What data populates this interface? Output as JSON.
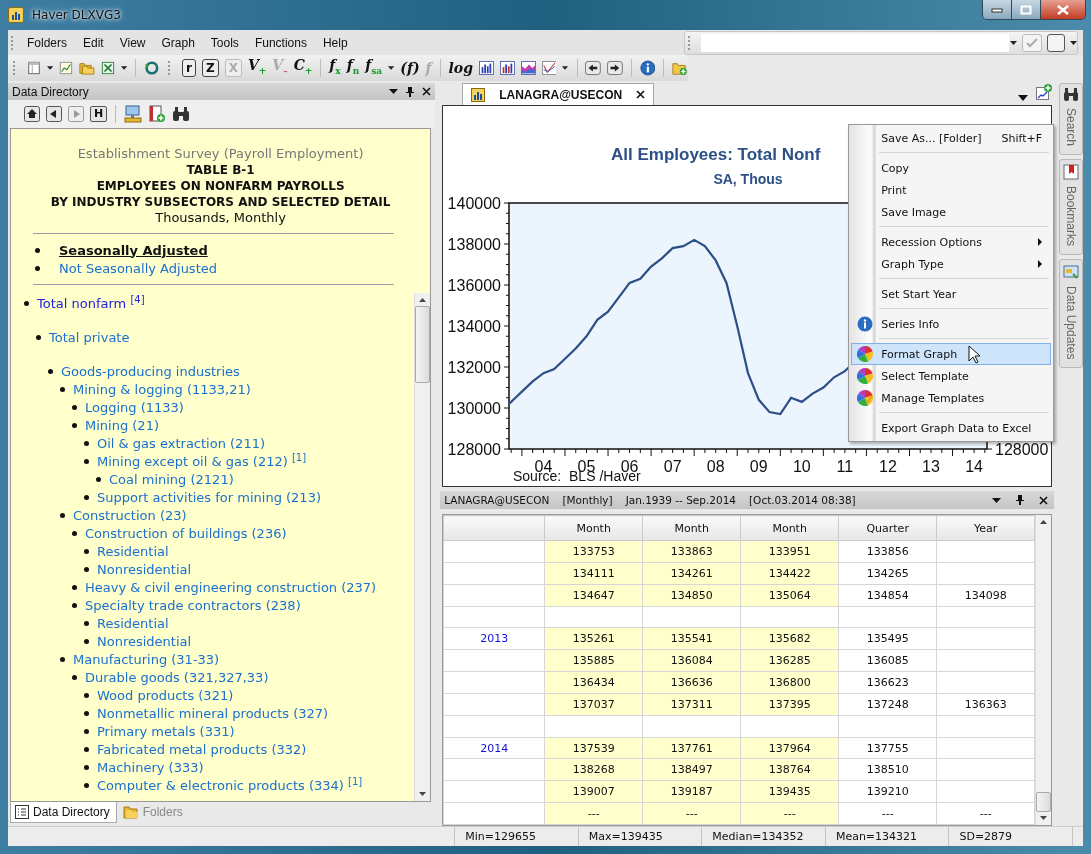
{
  "window": {
    "title": "Haver DLXVG3"
  },
  "menu": [
    "Folders",
    "Edit",
    "View",
    "Graph",
    "Tools",
    "Functions",
    "Help"
  ],
  "toolbar": {
    "glyph_buttons": [
      {
        "text": "r",
        "disabled": false
      },
      {
        "text": "Z",
        "disabled": false
      },
      {
        "text": "X",
        "disabled": true
      },
      {
        "text": "V$_{+}$",
        "disabled": false
      },
      {
        "text": "V$_{–}$",
        "disabled": true
      },
      {
        "text": "C$_{+}$",
        "disabled": false
      },
      {
        "text": "*f*$_{x}$",
        "disabled": false
      },
      {
        "text": "*f*$_{n}$",
        "disabled": false
      },
      {
        "text": "*f*$_{sa}$",
        "disabled": false
      },
      {
        "text": "(*f*)",
        "disabled": false
      },
      {
        "text": "*f*",
        "disabled": true
      },
      {
        "text": "log",
        "disabled": false
      }
    ]
  },
  "data_directory": {
    "title": "Data Directory",
    "history_button": "H",
    "heading": [
      {
        "kind": "survey",
        "text": "Establishment Survey (Payroll Employment)"
      },
      {
        "kind": "title",
        "text": "TABLE B-1"
      },
      {
        "kind": "title",
        "text": "EMPLOYEES ON NONFARM PAYROLLS"
      },
      {
        "kind": "title",
        "text": "BY INDUSTRY SUBSECTORS AND SELECTED DETAIL"
      },
      {
        "kind": "units",
        "text": "Thousands, Monthly"
      }
    ],
    "adjustments": [
      {
        "text": "Seasonally Adjusted",
        "selected": true
      },
      {
        "text": "Not Seasonally Adjusted",
        "selected": false
      }
    ],
    "tree": [
      {
        "text": "Total nonfarm $^{[4]}$",
        "children": [
          {
            "text": "Total private",
            "children": [
              {
                "text": "Goods-producing industries",
                "children": [
                  {
                    "text": "Mining & logging (1133,21)",
                    "children": [
                      {
                        "text": "Logging (1133)"
                      },
                      {
                        "text": "Mining (21)",
                        "children": [
                          {
                            "text": "Oil & gas extraction (211)"
                          },
                          {
                            "text": "Mining except oil & gas (212) $^{[1]}$",
                            "children": [
                              {
                                "text": "Coal mining (2121)"
                              }
                            ]
                          },
                          {
                            "text": "Support activities for mining (213)"
                          }
                        ]
                      }
                    ]
                  },
                  {
                    "text": "Construction (23)",
                    "children": [
                      {
                        "text": "Construction of buildings (236)",
                        "children": [
                          {
                            "text": "Residential"
                          },
                          {
                            "text": "Nonresidential"
                          }
                        ]
                      },
                      {
                        "text": "Heavy & civil engineering construction (237)"
                      },
                      {
                        "text": "Specialty trade contractors (238)",
                        "children": [
                          {
                            "text": "Residential"
                          },
                          {
                            "text": "Nonresidential"
                          }
                        ]
                      }
                    ]
                  },
                  {
                    "text": "Manufacturing (31-33)",
                    "children": [
                      {
                        "text": "Durable goods (321,327,33)",
                        "children": [
                          {
                            "text": "Wood products (321)"
                          },
                          {
                            "text": "Nonmetallic mineral products (327)"
                          },
                          {
                            "text": "Primary metals (331)"
                          },
                          {
                            "text": "Fabricated metal products (332)"
                          },
                          {
                            "text": "Machinery (333)"
                          },
                          {
                            "text": "Computer & electronic products (334) $^{[1]}$"
                          }
                        ]
                      }
                    ]
                  }
                ]
              }
            ]
          }
        ]
      }
    ],
    "tabs": [
      {
        "label": "Data Directory",
        "selected": true
      },
      {
        "label": "Folders",
        "selected": false
      }
    ]
  },
  "graph": {
    "tab": "LANAGRA@USECON",
    "chart_data": {
      "type": "line",
      "title": "All Employees: Total Nonf",
      "subtitle": "SA, Thous",
      "x": [
        3.2,
        3.35,
        3.5,
        3.75,
        4.0,
        4.25,
        4.5,
        4.75,
        5.0,
        5.25,
        5.5,
        5.75,
        6.0,
        6.25,
        6.5,
        6.75,
        7.0,
        7.25,
        7.5,
        7.75,
        8.0,
        8.25,
        8.5,
        8.75,
        9.0,
        9.25,
        9.5,
        9.75,
        10.0,
        10.25,
        10.5,
        10.75,
        11.0,
        11.1
      ],
      "values": [
        130200,
        130500,
        130800,
        131300,
        131700,
        131900,
        132400,
        132900,
        133500,
        134300,
        134700,
        135400,
        136100,
        136300,
        136900,
        137300,
        137800,
        137900,
        138200,
        137900,
        137200,
        136100,
        134000,
        131700,
        130400,
        129800,
        129700,
        130500,
        130300,
        130700,
        131000,
        131500,
        131800,
        132000
      ],
      "xlim": [
        3.2,
        14.3
      ],
      "ylim": [
        128000,
        140000
      ],
      "xticks": [
        {
          "value": 4,
          "label": "04"
        },
        {
          "value": 5,
          "label": "05"
        },
        {
          "value": 6,
          "label": "06"
        },
        {
          "value": 7,
          "label": "07"
        },
        {
          "value": 8,
          "label": "08"
        },
        {
          "value": 9,
          "label": "09"
        },
        {
          "value": 10,
          "label": "10"
        },
        {
          "value": 11,
          "label": "11"
        },
        {
          "value": 12,
          "label": "12"
        },
        {
          "value": 13,
          "label": "13"
        },
        {
          "value": 14,
          "label": "14"
        }
      ],
      "yticks": [
        128000,
        130000,
        132000,
        134000,
        136000,
        138000,
        140000
      ]
    },
    "right_axis_label": "128000",
    "source": "Source:  BLS /Haver",
    "context_menu": [
      {
        "kind": "item",
        "label": "Save As... [Folder]",
        "shortcut": "Shift+F",
        "submenu": false,
        "selected": false
      },
      {
        "kind": "separator"
      },
      {
        "kind": "item",
        "label": "Copy",
        "submenu": false,
        "selected": false
      },
      {
        "kind": "item",
        "label": "Print",
        "submenu": false,
        "selected": false
      },
      {
        "kind": "item",
        "label": "Save Image",
        "submenu": false,
        "selected": false
      },
      {
        "kind": "separator"
      },
      {
        "kind": "item",
        "label": "Recession Options",
        "submenu": true,
        "selected": false
      },
      {
        "kind": "item",
        "label": "Graph Type",
        "submenu": true,
        "selected": false
      },
      {
        "kind": "separator"
      },
      {
        "kind": "item",
        "label": "Set Start Year",
        "submenu": false,
        "selected": false
      },
      {
        "kind": "separator"
      },
      {
        "kind": "item",
        "label": "Series Info",
        "submenu": false,
        "selected": false
      },
      {
        "kind": "separator"
      },
      {
        "kind": "item",
        "label": "Format Graph",
        "submenu": false,
        "selected": true
      },
      {
        "kind": "item",
        "label": "Select Template",
        "submenu": false,
        "selected": false
      },
      {
        "kind": "item",
        "label": "Manage Templates",
        "submenu": false,
        "selected": false
      },
      {
        "kind": "separator"
      },
      {
        "kind": "item",
        "label": "Export Graph Data to Excel",
        "submenu": false,
        "selected": false
      }
    ]
  },
  "data_panel": {
    "header": [
      "LANAGRA@USECON",
      "[Monthly]",
      "Jan.1939 -- Sep.2014",
      "[Oct.03.2014 08:38]"
    ],
    "columns": [
      "Month",
      "Month",
      "Month",
      "Quarter",
      "Year"
    ],
    "rows": [
      {
        "cells": [
          "133753",
          "133863",
          "133951",
          "133856",
          null
        ]
      },
      {
        "cells": [
          "134111",
          "134261",
          "134422",
          "134265",
          null
        ]
      },
      {
        "cells": [
          "134647",
          "134850",
          "135064",
          "134854",
          "134098"
        ]
      },
      {
        "kind": "blank"
      },
      {
        "label": "2013",
        "cells": [
          "135261",
          "135541",
          "135682",
          "135495",
          null
        ]
      },
      {
        "cells": [
          "135885",
          "136084",
          "136285",
          "136085",
          null
        ]
      },
      {
        "cells": [
          "136434",
          "136636",
          "136800",
          "136623",
          null
        ]
      },
      {
        "cells": [
          "137037",
          "137311",
          "137395",
          "137248",
          "136363"
        ]
      },
      {
        "kind": "blank"
      },
      {
        "label": "2014",
        "cells": [
          "137539",
          "137761",
          "137964",
          "137755",
          null
        ]
      },
      {
        "cells": [
          "138268",
          "138497",
          "138764",
          "138510",
          null
        ]
      },
      {
        "cells": [
          "139007",
          "139187",
          "139435",
          "139210",
          null
        ]
      },
      {
        "cells": [
          "---",
          "---",
          "---",
          "---",
          "---"
        ]
      }
    ]
  },
  "side_tabs": [
    "Search",
    "Bookmarks",
    "Data Updates"
  ],
  "status_bar": [
    "Min=129655",
    "Max=139435",
    "Median=134352",
    "Mean=134321",
    "SD=2879"
  ]
}
